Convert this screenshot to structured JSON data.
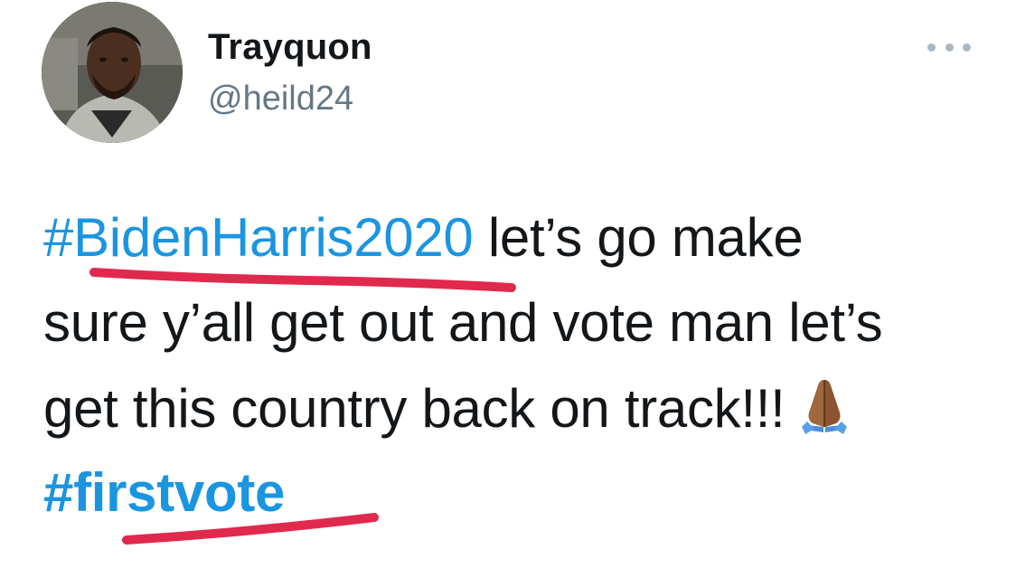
{
  "author": {
    "display_name": "Trayquon",
    "handle": "@heild24"
  },
  "more_menu": {
    "icon": "more-dots-icon"
  },
  "tweet": {
    "line1_hashtag": "#BidenHarris2020",
    "line1_text": " let’s go make",
    "line2_text": "sure y’all get out and vote man let’s",
    "line3_text": "get this country back on track!!!",
    "line3_emoji": "folded-hands-icon",
    "line4_hashtag": "#firstvote"
  },
  "colors": {
    "hashtag": "#1b95e0",
    "text": "#14171a",
    "handle": "#657786",
    "annotation_underline": "#e0294d"
  }
}
